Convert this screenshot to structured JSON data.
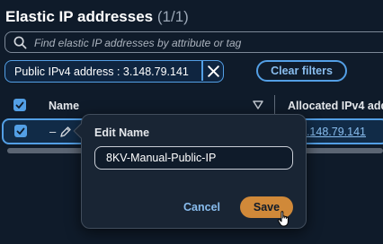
{
  "header": {
    "title": "Elastic IP addresses",
    "count": "(1/1)"
  },
  "search": {
    "placeholder": "Find elastic IP addresses by attribute or tag",
    "icon": "search-icon"
  },
  "filter": {
    "token_label": "Public IPv4 address : 3.148.79.141",
    "remove_icon": "close-icon",
    "clear_label": "Clear filters"
  },
  "table": {
    "columns": [
      "Name",
      "Allocated IPv4 add"
    ],
    "rows": [
      {
        "name": "–",
        "ipv4": "3.148.79.141",
        "selected": true
      }
    ]
  },
  "popover": {
    "title": "Edit Name",
    "input_value": "8KV-Manual-Public-IP",
    "cancel_label": "Cancel",
    "save_label": "Save"
  },
  "colors": {
    "background": "#0f1b2a",
    "accent": "#539fe5",
    "primary_button": "#d08939"
  }
}
